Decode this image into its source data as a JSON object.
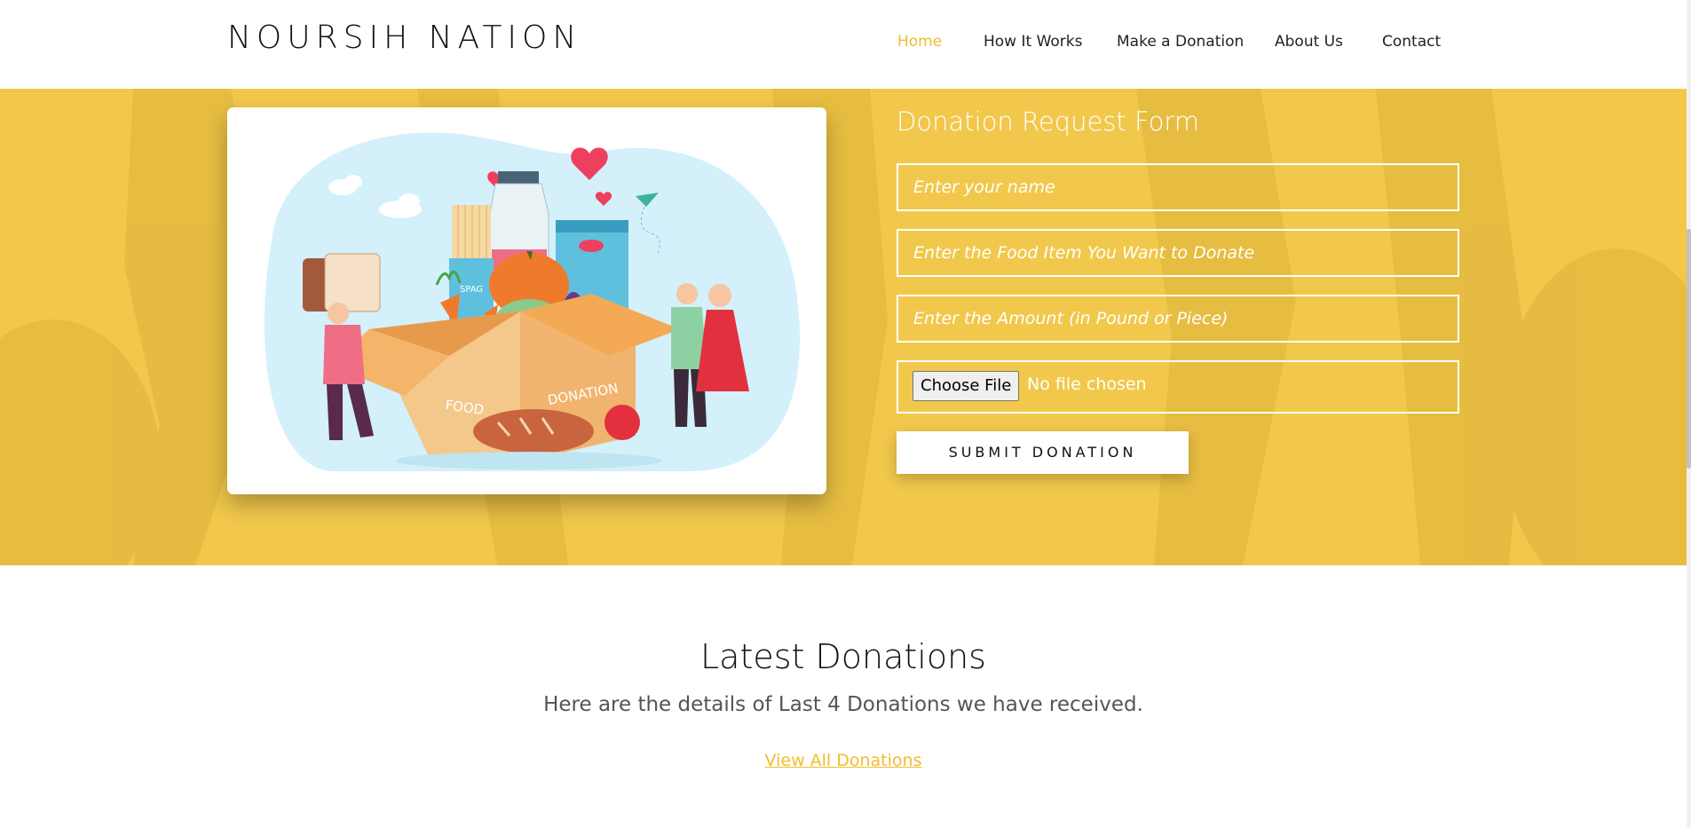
{
  "nav": {
    "brand": "NOURSIH NATION",
    "items": [
      {
        "label": "Home",
        "active": true
      },
      {
        "label": "How It Works",
        "active": false
      },
      {
        "label": "Make a Donation",
        "active": false
      },
      {
        "label": "About Us",
        "active": false
      },
      {
        "label": "Contact",
        "active": false
      }
    ]
  },
  "illustration": {
    "box_left_label": "FOOD",
    "box_right_label": "DONATION",
    "pack_label": "SPAG"
  },
  "form": {
    "title": "Donation Request Form",
    "name_placeholder": "Enter your name",
    "food_placeholder": "Enter the Food Item You Want to Donate",
    "amount_placeholder": "Enter the Amount (in Pound or Piece)",
    "file_button": "Choose File",
    "file_status": "No file chosen",
    "submit_label": "SUBMIT DONATION"
  },
  "latest": {
    "title": "Latest Donations",
    "subtitle": "Here are the details of Last 4 Donations we have received.",
    "view_all": "View All Donations"
  },
  "colors": {
    "accent": "#f0bd2e",
    "hero_bg": "#f1c84b"
  }
}
